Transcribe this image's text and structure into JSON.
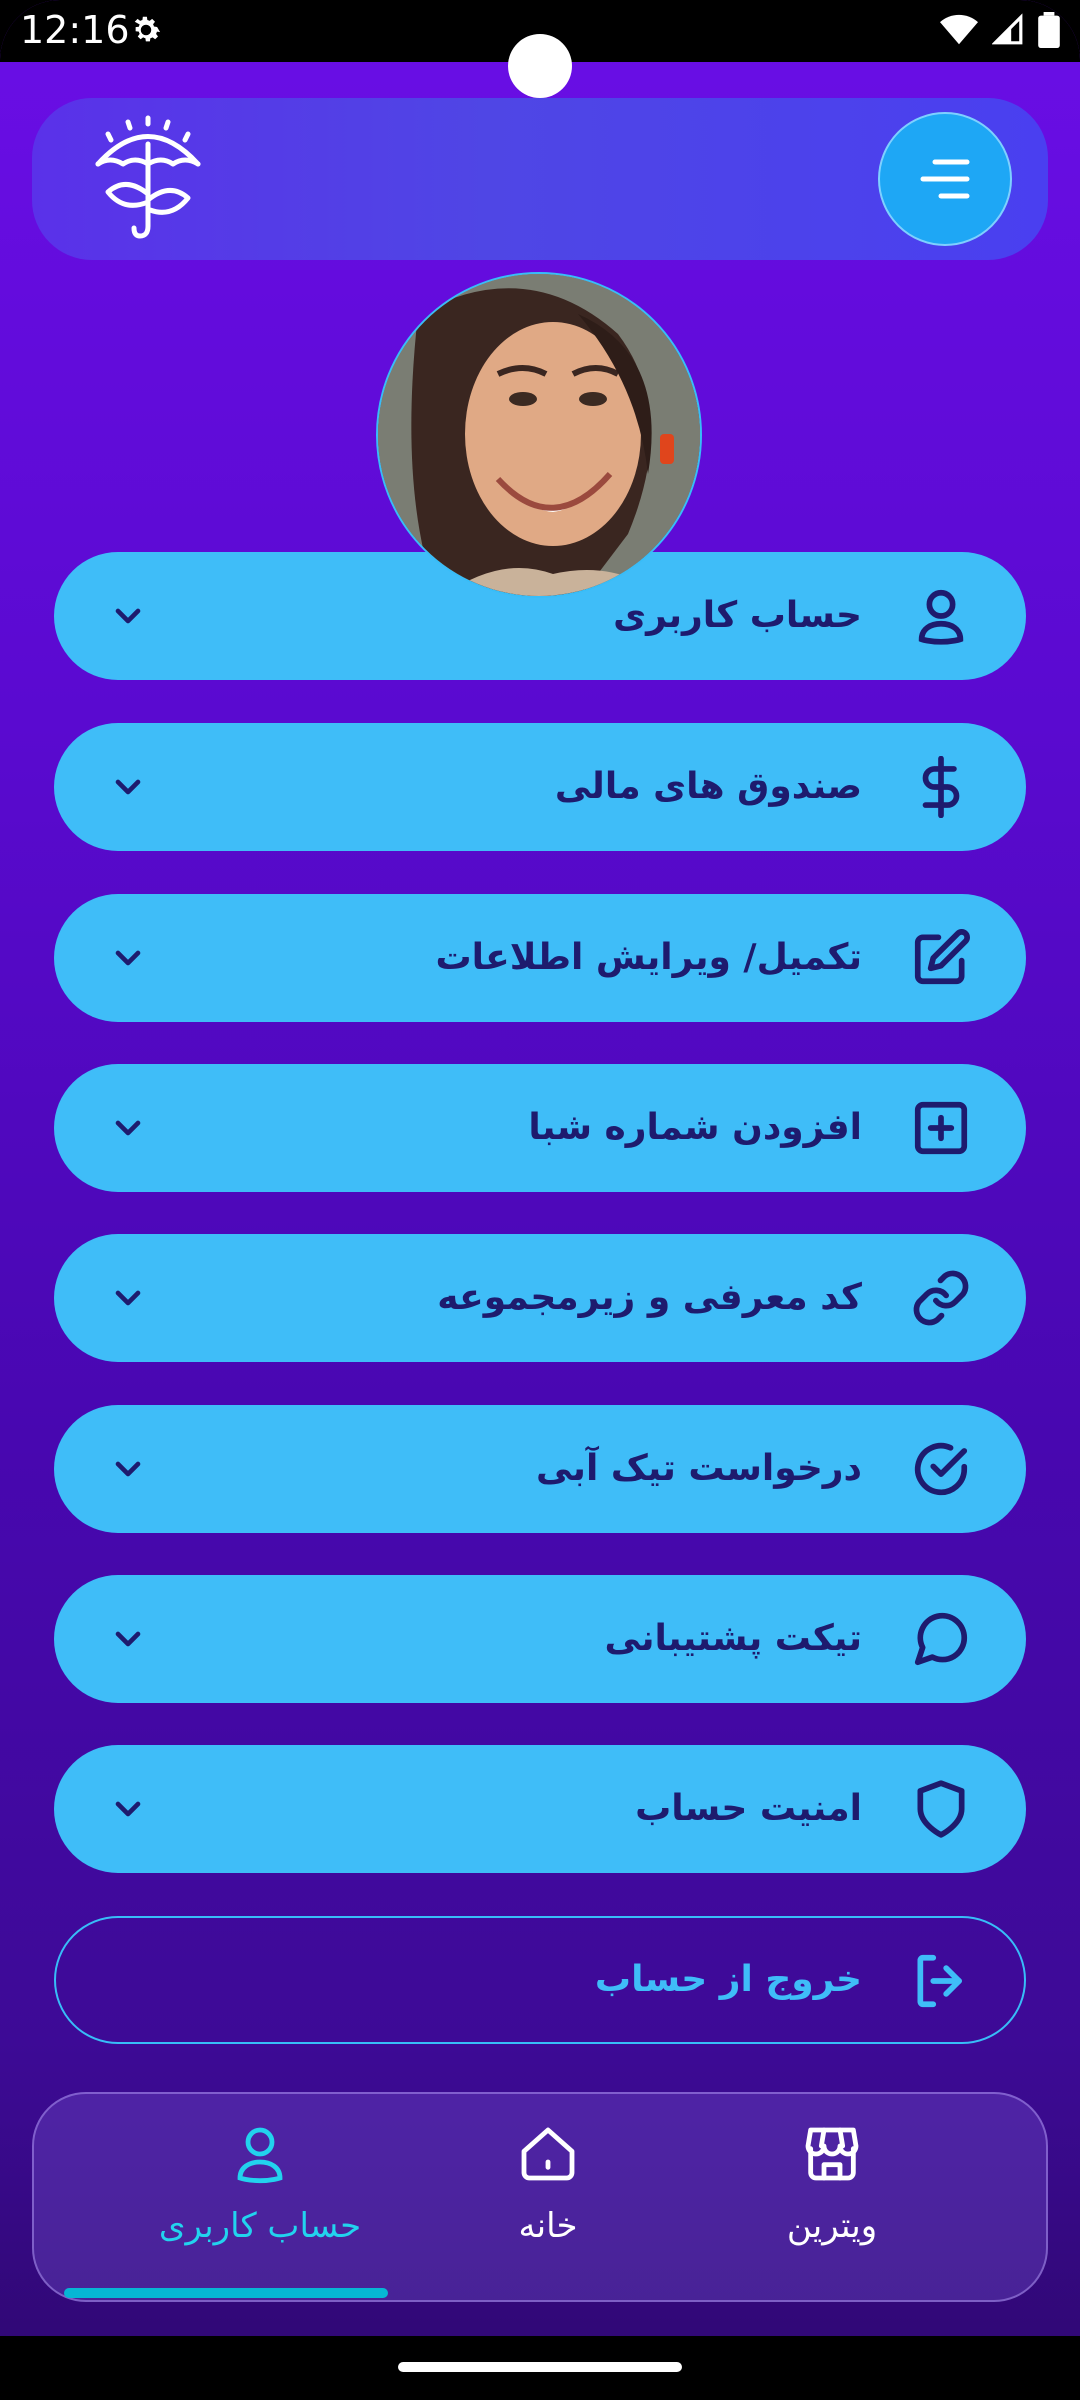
{
  "status_bar": {
    "time": "12:16"
  },
  "menu_items": [
    {
      "label": "حساب کاربری",
      "icon": "user-icon"
    },
    {
      "label": "صندوق های مالی",
      "icon": "dollar-icon"
    },
    {
      "label": "تکمیل/ ویرایش اطلاعات",
      "icon": "edit-icon"
    },
    {
      "label": "افزودن شماره شبا",
      "icon": "plus-square-icon"
    },
    {
      "label": "کد معرفی و زیرمجموعه",
      "icon": "link-icon"
    },
    {
      "label": "درخواست تیک آبی",
      "icon": "check-circle-icon"
    },
    {
      "label": "تیکت پشتیبانی",
      "icon": "chat-icon"
    },
    {
      "label": "امنیت حساب",
      "icon": "shield-icon"
    }
  ],
  "logout": {
    "label": "خروج از حساب",
    "icon": "logout-icon"
  },
  "bottom_nav": [
    {
      "label": "حساب کاربری",
      "icon": "user-icon",
      "active": true
    },
    {
      "label": "خانه",
      "icon": "home-icon",
      "active": false
    },
    {
      "label": "ویترین",
      "icon": "store-icon",
      "active": false
    }
  ],
  "colors": {
    "accent": "#3fbdf8",
    "menu_text": "#1e1b6e",
    "nav_active": "#22d3ee",
    "nav_inactive": "#ffffff"
  }
}
